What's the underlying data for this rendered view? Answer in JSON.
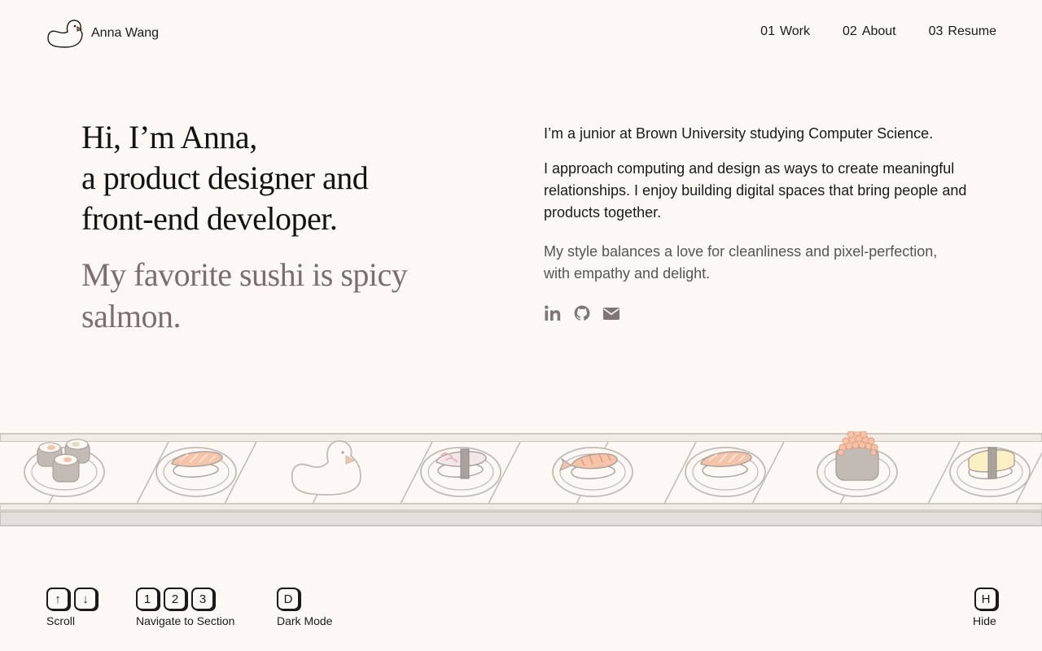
{
  "header": {
    "brand_name": "Anna Wang",
    "nav": [
      {
        "num": "01",
        "label": "Work"
      },
      {
        "num": "02",
        "label": "About"
      },
      {
        "num": "03",
        "label": "Resume"
      }
    ]
  },
  "hero": {
    "headline_lines": [
      "Hi, I’m Anna,",
      "a product designer and",
      "front-end developer."
    ],
    "subline": "My favorite sushi is spicy salmon.",
    "paragraphs": [
      "I’m a junior at Brown University studying Computer Science.",
      "I approach computing and design as ways to create meaningful relationships. I enjoy building digital spaces that bring people and products together.",
      "My style balances a love for cleanliness and pixel-perfection, with empathy and delight."
    ],
    "socials": [
      "linkedin-icon",
      "github-icon",
      "email-icon"
    ]
  },
  "conveyor": {
    "items": [
      "maki-roll",
      "salmon-nigiri",
      "duck",
      "squid-nigiri",
      "shrimp-nigiri",
      "salmon-nigiri",
      "ikura-gunkan",
      "tamago-nigiri"
    ]
  },
  "shortcuts": {
    "scroll": {
      "keys": [
        "↑",
        "↓"
      ],
      "label": "Scroll"
    },
    "navigate": {
      "keys": [
        "1",
        "2",
        "3"
      ],
      "label": "Navigate to Section"
    },
    "dark": {
      "keys": [
        "D"
      ],
      "label": "Dark Mode"
    },
    "hide": {
      "keys": [
        "H"
      ],
      "label": "Hide"
    }
  },
  "colors": {
    "background": "#fdf8f3",
    "text": "#1c1a18",
    "muted_heading": "#7a6f6c",
    "salmon": "#f5c3a8",
    "plate_stroke": "#c2bab5"
  }
}
